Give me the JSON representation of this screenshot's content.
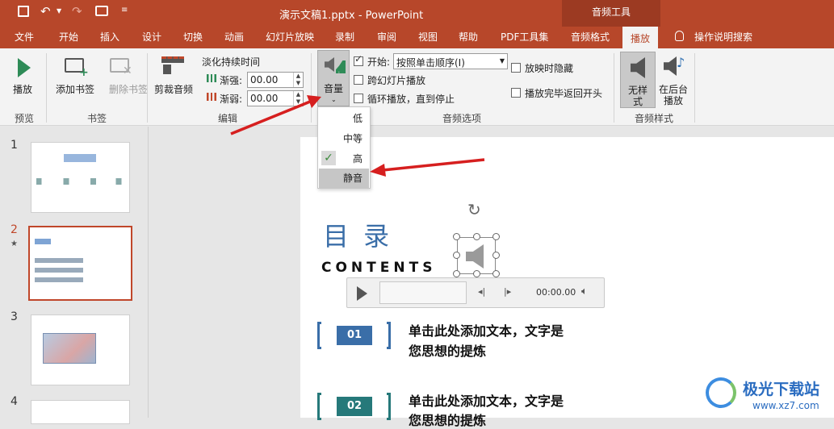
{
  "title_bar": {
    "file_title": "演示文稿1.pptx - PowerPoint",
    "context_tab_group": "音频工具",
    "qat_icons": [
      "save-icon",
      "undo-icon",
      "redo-icon",
      "present-icon",
      "customize-icon"
    ]
  },
  "tabs": [
    "文件",
    "开始",
    "插入",
    "设计",
    "切换",
    "动画",
    "幻灯片放映",
    "录制",
    "审阅",
    "视图",
    "帮助",
    "PDF工具集",
    "音频格式",
    "播放"
  ],
  "tell_me": "操作说明搜索",
  "ribbon": {
    "preview": {
      "play_label": "播放",
      "group_label": "预览"
    },
    "bookmarks": {
      "add_label": "添加书签",
      "remove_label": "删除书签",
      "group_label": "书签"
    },
    "editing": {
      "trim_label": "剪裁音频",
      "fade_title": "淡化持续时间",
      "fade_in_label": "渐强:",
      "fade_in_value": "00.00",
      "fade_out_label": "渐弱:",
      "fade_out_value": "00.00",
      "group_label": "编辑"
    },
    "audio_options": {
      "volume_label": "音量",
      "start_label": "开始:",
      "start_value": "按照单击顺序(I)",
      "play_across_slides": "跨幻灯片播放",
      "loop_label": "循环播放，直到停止",
      "hide_during_show": "放映时隐藏",
      "rewind_after": "播放完毕返回开头",
      "group_label": "音频选项",
      "start_checked": true
    },
    "audio_styles": {
      "no_style_label": "无样式",
      "play_bg_label": "在后台播放",
      "group_label": "音频样式"
    }
  },
  "volume_menu": {
    "items": [
      "低",
      "中等",
      "高",
      "静音"
    ],
    "checked": "高",
    "highlighted": "静音"
  },
  "slides": {
    "numbers": [
      "1",
      "2",
      "3",
      "4"
    ],
    "selected": 2,
    "star": "★"
  },
  "slide": {
    "title": "目 录",
    "subtitle": "CONTENTS",
    "items": [
      {
        "num": "01",
        "text1": "单击此处添加文本，文字是",
        "text2": "您思想的提炼",
        "color": "#3a6ea8"
      },
      {
        "num": "02",
        "text1": "单击此处添加文本，文字是",
        "text2": "您思想的提炼",
        "color": "#26797a"
      }
    ]
  },
  "player": {
    "time": "00:00.00"
  },
  "watermark": {
    "cn": "极光下载站",
    "url": "www.xz7.com"
  },
  "colors": {
    "accent": "#b7472a",
    "title_blue": "#3a6ea8",
    "teal": "#26797a",
    "arrow": "#d61f1f"
  }
}
